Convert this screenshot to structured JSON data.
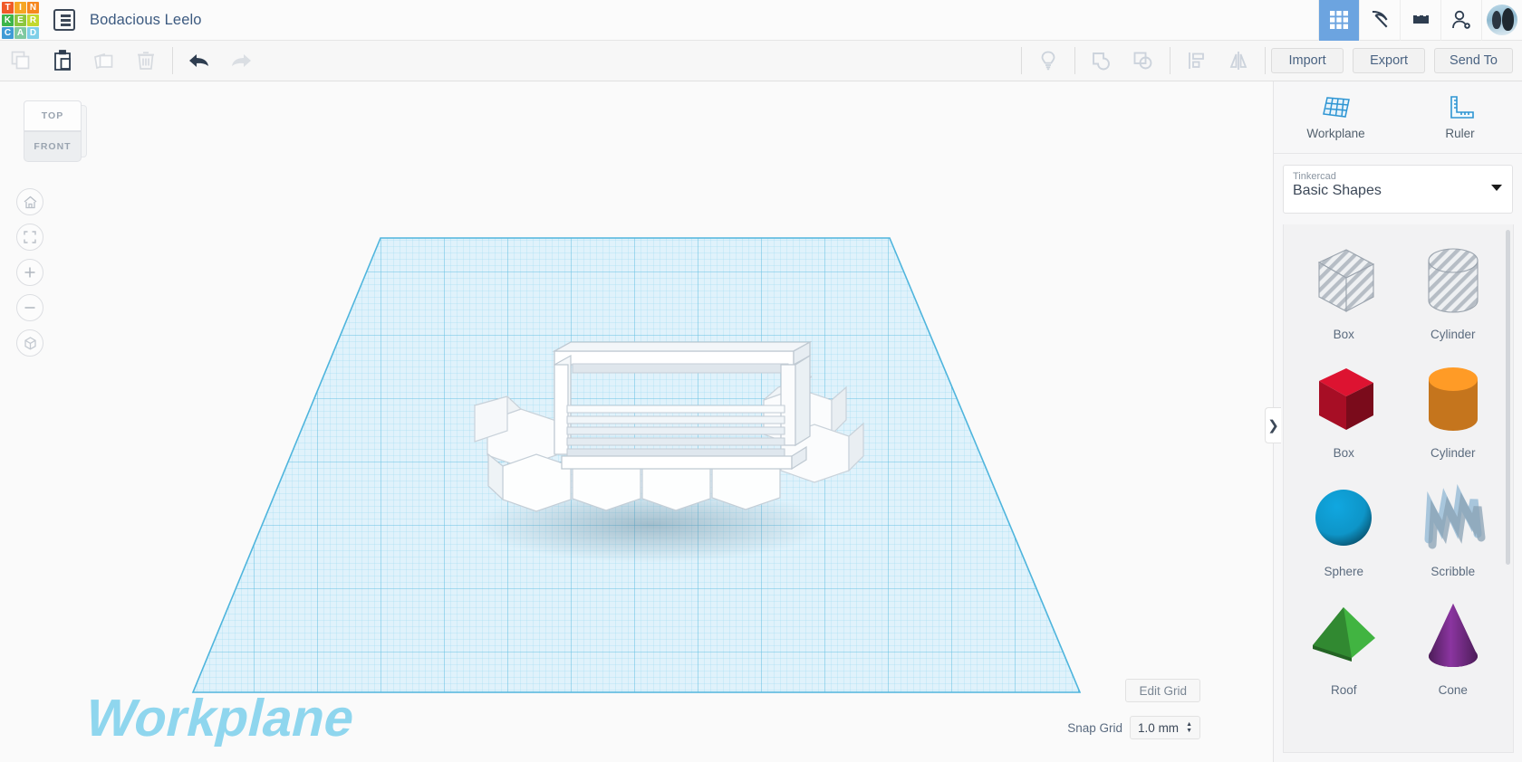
{
  "app": {
    "logo_letters": [
      "T",
      "I",
      "N",
      "K",
      "E",
      "R",
      "C",
      "A",
      "D"
    ],
    "logo_colors": [
      "#f05a28",
      "#f6a623",
      "#f6871f",
      "#3db54a",
      "#8cc63e",
      "#c3d82e",
      "#3f9bd6",
      "#7fc9a0",
      "#7fcfe8"
    ],
    "project_title": "Bodacious Leelo",
    "document_icon": "list-document-icon"
  },
  "topbar_right": {
    "items": [
      {
        "name": "grid-view-button",
        "icon": "grid-icon",
        "active": true
      },
      {
        "name": "codeblocks-button",
        "icon": "pickaxe-icon",
        "active": false
      },
      {
        "name": "blocks-button",
        "icon": "lego-brick-icon",
        "active": false
      },
      {
        "name": "invite-button",
        "icon": "add-person-icon",
        "active": false
      }
    ],
    "avatar_label": "user-avatar"
  },
  "toolbar": {
    "left_icons": [
      {
        "name": "copy-button",
        "icon": "copy-icon",
        "enabled": false
      },
      {
        "name": "paste-button",
        "icon": "paste-icon",
        "enabled": true
      },
      {
        "name": "duplicate-button",
        "icon": "duplicate-icon",
        "enabled": false
      },
      {
        "name": "delete-button",
        "icon": "trash-icon",
        "enabled": false
      },
      {
        "name": "undo-button",
        "icon": "undo-arrow-icon",
        "enabled": true
      },
      {
        "name": "redo-button",
        "icon": "redo-arrow-icon",
        "enabled": false
      }
    ],
    "right_icons": [
      {
        "name": "light-button",
        "icon": "lightbulb-icon",
        "enabled": false
      },
      {
        "name": "group-button",
        "icon": "group-shapes-icon",
        "enabled": false
      },
      {
        "name": "ungroup-button",
        "icon": "ungroup-shapes-icon",
        "enabled": false
      },
      {
        "name": "align-button",
        "icon": "align-icon",
        "enabled": false
      },
      {
        "name": "mirror-button",
        "icon": "mirror-icon",
        "enabled": false
      }
    ],
    "import_label": "Import",
    "export_label": "Export",
    "sendto_label": "Send To"
  },
  "canvas": {
    "viewcube_top": "TOP",
    "viewcube_front": "FRONT",
    "nav_buttons": [
      {
        "name": "home-view-button",
        "icon": "home-icon"
      },
      {
        "name": "fit-view-button",
        "icon": "fit-frame-icon"
      },
      {
        "name": "zoom-in-button",
        "icon": "plus-icon"
      },
      {
        "name": "zoom-out-button",
        "icon": "minus-icon"
      },
      {
        "name": "perspective-toggle-button",
        "icon": "cube-view-icon"
      }
    ],
    "workplane_label": "Workplane",
    "edit_grid_label": "Edit Grid",
    "snap_grid_label": "Snap Grid",
    "snap_grid_value": "1.0 mm",
    "grid_color": "#7fd2ee",
    "plane_fill": "#ddf1fa"
  },
  "right_panel": {
    "tools": [
      {
        "label": "Workplane",
        "icon": "workplane-icon"
      },
      {
        "label": "Ruler",
        "icon": "ruler-icon"
      }
    ],
    "library": {
      "category": "Tinkercad",
      "name": "Basic Shapes"
    },
    "shapes": [
      {
        "label": "Box",
        "icon": "hole-box-shape",
        "color": "#b9bfc6",
        "kind": "hole-box"
      },
      {
        "label": "Cylinder",
        "icon": "hole-cylinder-shape",
        "color": "#b9bfc6",
        "kind": "hole-cylinder"
      },
      {
        "label": "Box",
        "icon": "solid-box-shape",
        "color": "#c5112c",
        "kind": "box"
      },
      {
        "label": "Cylinder",
        "icon": "solid-cylinder-shape",
        "color": "#e88a22",
        "kind": "cylinder"
      },
      {
        "label": "Sphere",
        "icon": "solid-sphere-shape",
        "color": "#0e95c8",
        "kind": "sphere"
      },
      {
        "label": "Scribble",
        "icon": "scribble-shape",
        "color": "#a8c6dc",
        "kind": "scribble"
      },
      {
        "label": "Roof",
        "icon": "solid-roof-shape",
        "color": "#3aa13a",
        "kind": "roof"
      },
      {
        "label": "Cone",
        "icon": "solid-cone-shape",
        "color": "#7c2f8f",
        "kind": "cone"
      }
    ]
  }
}
